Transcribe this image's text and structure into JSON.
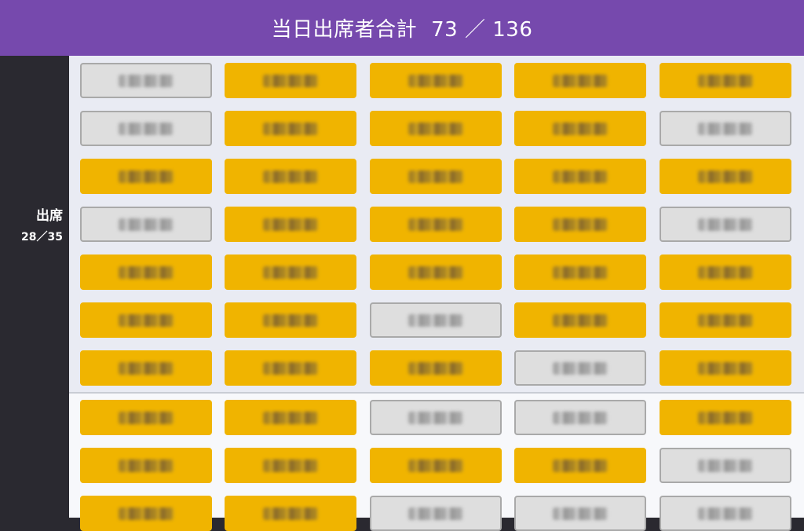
{
  "header": {
    "title": "当日出席者合計",
    "count": "73 ／ 136"
  },
  "sections": [
    {
      "name": "出席",
      "ratio": "28／35",
      "rows": [
        [
          "absent",
          "present",
          "present",
          "present",
          "present"
        ],
        [
          "absent",
          "present",
          "present",
          "present",
          "absent"
        ],
        [
          "present",
          "present",
          "present",
          "present",
          "present"
        ],
        [
          "absent",
          "present",
          "present",
          "present",
          "absent"
        ],
        [
          "present",
          "present",
          "present",
          "present",
          "present"
        ],
        [
          "present",
          "present",
          "absent",
          "present",
          "present"
        ],
        [
          "present",
          "present",
          "present",
          "absent",
          "present"
        ]
      ]
    },
    {
      "name": "",
      "ratio": "",
      "rows": [
        [
          "present",
          "present",
          "absent",
          "absent",
          "present"
        ],
        [
          "present",
          "present",
          "present",
          "present",
          "absent"
        ],
        [
          "present",
          "present",
          "absent",
          "absent",
          "absent"
        ]
      ]
    }
  ],
  "colors": {
    "header_bg": "#7649ad",
    "present_card": "#f0b400",
    "absent_card": "#dedede",
    "sidebar_bg": "#2a2930"
  }
}
